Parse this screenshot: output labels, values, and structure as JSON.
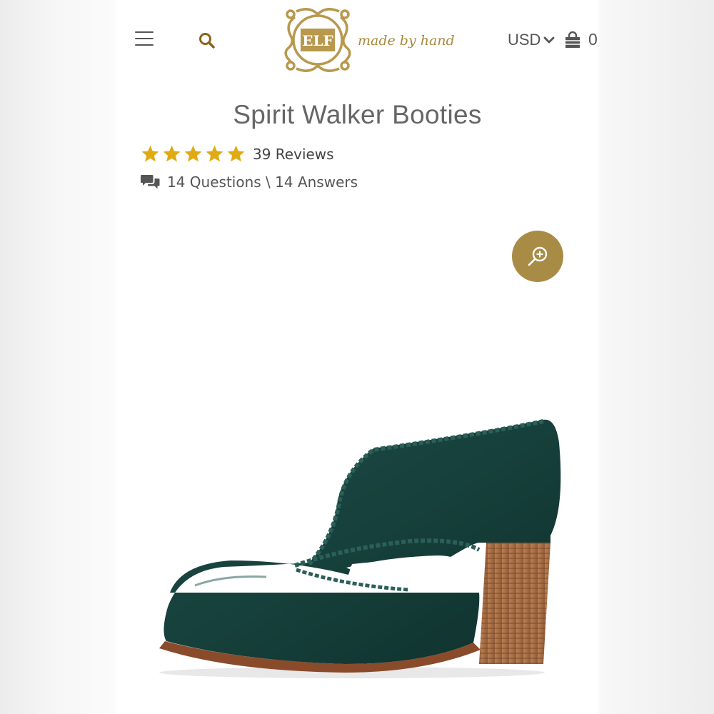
{
  "header": {
    "brand_mark": "ELF",
    "brand_tagline": "made by hand",
    "currency": "USD",
    "cart_count": "0",
    "icons": [
      "menu-icon",
      "search-icon",
      "chevron-down-icon",
      "shopping-bag-icon"
    ]
  },
  "product": {
    "title": "Spirit Walker Booties",
    "rating": 5,
    "rating_max": 5,
    "reviews_label": "39 Reviews",
    "qa_label": "14 Questions \\ 14 Answers"
  },
  "gallery": {
    "zoom_icon": "zoom-in-icon",
    "image": "green-leather-bootie-with-braided-trim-and-wooden-heel"
  },
  "colors": {
    "accent_gold": "#a88b45",
    "star_gold": "#e0aa12",
    "text_gray": "#555555",
    "title_gray": "#666666",
    "shoe_green": "#16403b",
    "heel_wood": "#a86f44"
  }
}
